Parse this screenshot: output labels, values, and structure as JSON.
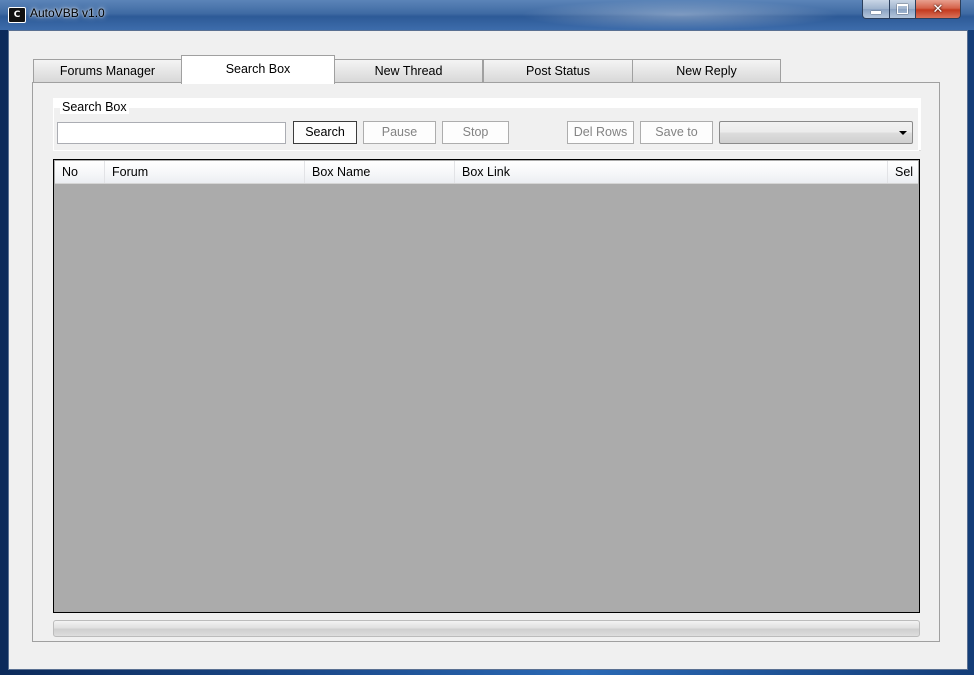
{
  "window": {
    "title": "AutoVBB v1.0",
    "icon": "app-logo-icon",
    "controls": {
      "minimize": "minimize-icon",
      "maximize": "maximize-icon",
      "close": "close-icon",
      "close_glyph": "✕"
    }
  },
  "tabs": [
    {
      "label": "Forums Manager",
      "active": false
    },
    {
      "label": "Search Box",
      "active": true
    },
    {
      "label": "New Thread",
      "active": false
    },
    {
      "label": "Post Status",
      "active": false
    },
    {
      "label": "New Reply",
      "active": false
    }
  ],
  "search_group": {
    "title": "Search Box",
    "input_value": "",
    "buttons": {
      "search": "Search",
      "pause": "Pause",
      "stop": "Stop",
      "del_rows": "Del Rows",
      "save_to": "Save to"
    },
    "dropdown_value": ""
  },
  "grid": {
    "columns": [
      "No",
      "Forum",
      "Box Name",
      "Box Link",
      "Sel"
    ],
    "rows": []
  },
  "progress": {
    "value": 0
  }
}
